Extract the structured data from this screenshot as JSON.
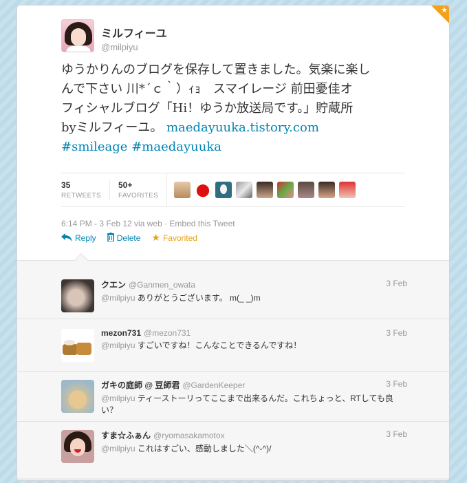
{
  "tweet": {
    "fullname": "ミルフィーユ",
    "screenname": "@milpiyu",
    "text_line_1": "ゆうかりんのブログを保存して置きました。気楽に楽し",
    "text_line_2": "んで下さい 川*´ｃ｀）ｨｮ　スマイレージ 前田憂佳オ",
    "text_line_3": "フィシャルブログ「Hi！ゆうか放送局です。」貯蔵所",
    "text_line_4_pre": "byミルフィーユ。",
    "link": "maedayuuka.tistory.com",
    "hashtag_1": "#smileage",
    "hashtag_2": "#maedayuuka",
    "retweets_count": "35",
    "retweets_label": "RETWEETS",
    "favorites_count": "50+",
    "favorites_label": "FAVORITES",
    "timestamp": "6:14 PM - 3 Feb 12 via web",
    "separator": " · ",
    "embed": "Embed this Tweet",
    "favorited_icon": "favorited-star-icon",
    "accent_color": "#0084b4",
    "favorite_color": "#e8a015"
  },
  "actions": {
    "reply": "Reply",
    "delete": "Delete",
    "favorited": "Favorited"
  },
  "replies": [
    {
      "name": "クエン",
      "screen": "@Ganmen_owata",
      "time": "3 Feb",
      "mention": "@milpiyu",
      "text": " ありがとうございます。 m(_ _)m"
    },
    {
      "name": "mezon731",
      "screen": "@mezon731",
      "time": "3 Feb",
      "mention": "@milpiyu",
      "text": " すごいですね！こんなことできるんですね！"
    },
    {
      "name": "ガキの庭師 @ 豆師君",
      "screen": "@GardenKeeper",
      "time": "3 Feb",
      "mention": "@milpiyu",
      "text": " ティーストーリってここまで出来るんだ。これちょっと、RTしても良い？"
    },
    {
      "name": "すま☆ふぁん",
      "screen": "@ryomasakamotox",
      "time": "3 Feb",
      "mention": "@milpiyu",
      "text": " これはすごい、感動しました＼(^-^)/"
    }
  ]
}
